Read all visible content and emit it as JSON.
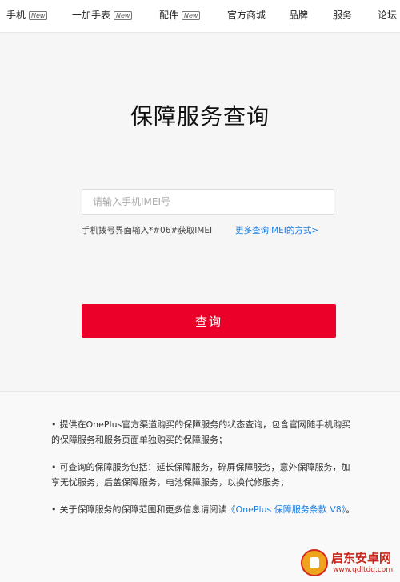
{
  "nav": {
    "items": [
      {
        "label": "手机",
        "badge": "New"
      },
      {
        "label": "一加手表",
        "badge": "New"
      },
      {
        "label": "配件",
        "badge": "New"
      },
      {
        "label": "官方商城"
      },
      {
        "label": "品牌"
      },
      {
        "label": "服务"
      },
      {
        "label": "论坛"
      }
    ]
  },
  "main": {
    "title": "保障服务查询",
    "imei_placeholder": "请输入手机IMEI号",
    "hint": "手机拨号界面输入*#06#获取IMEI",
    "more_link": "更多查询IMEI的方式>",
    "query_button": "查询"
  },
  "notes": [
    {
      "text": "提供在OnePlus官方渠道购买的保障服务的状态查询，包含官网随手机购买的保障服务和服务页面单独购买的保障服务；"
    },
    {
      "text": "可查询的保障服务包括：延长保障服务，碎屏保障服务，意外保障服务，加享无忧服务，后盖保障服务，电池保障服务，以换代修服务；"
    },
    {
      "text": "关于保障服务的保障范围和更多信息请阅读",
      "link": "《OnePlus 保障服务条款 V8》",
      "suffix": "。"
    }
  ],
  "watermark": {
    "line1": "启东安卓网",
    "line2": "www.qdltdq.com"
  },
  "colors": {
    "accent": "#eb0029",
    "link": "#1c7de0"
  }
}
